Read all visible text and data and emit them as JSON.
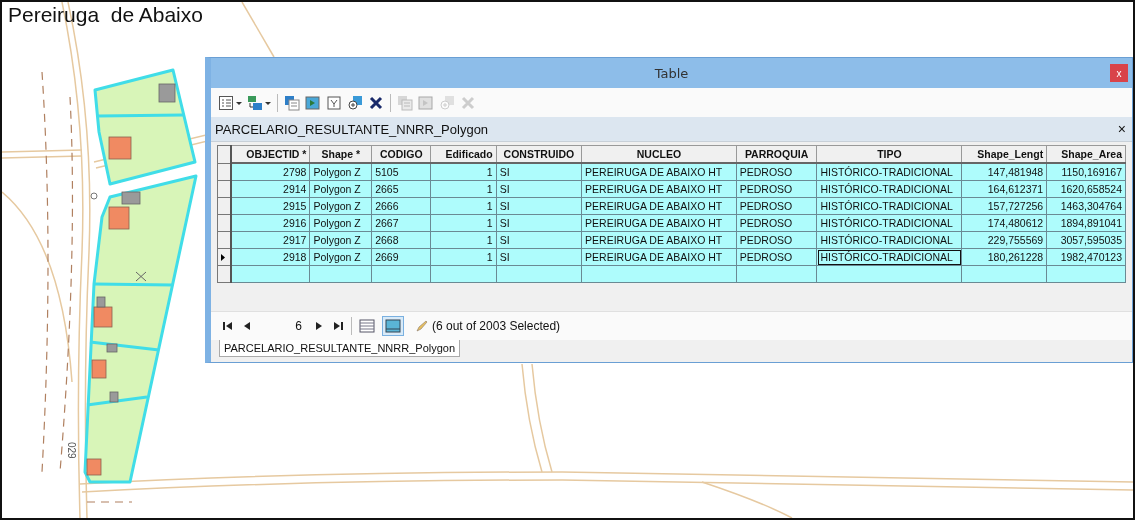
{
  "map": {
    "title": "Pereiruga  de Abaixo",
    "road_label": "029"
  },
  "window": {
    "title": "Table",
    "close": "x"
  },
  "toolbar": [
    {
      "kind": "options",
      "menu": true,
      "disabled": false
    },
    {
      "kind": "related",
      "menu": true,
      "disabled": false
    },
    {
      "kind": "select-attr",
      "menu": false,
      "disabled": false
    },
    {
      "kind": "switch",
      "menu": false,
      "disabled": false
    },
    {
      "kind": "clear",
      "menu": false,
      "disabled": false
    },
    {
      "kind": "zoom",
      "menu": false,
      "disabled": false
    },
    {
      "kind": "delete",
      "menu": false,
      "disabled": false
    },
    {
      "kind": "select-attr",
      "menu": false,
      "disabled": true
    },
    {
      "kind": "switch",
      "menu": false,
      "disabled": true
    },
    {
      "kind": "zoom",
      "menu": false,
      "disabled": true
    },
    {
      "kind": "delete",
      "menu": false,
      "disabled": true
    }
  ],
  "layer": {
    "title": "PARCELARIO_RESULTANTE_NNRR_Polygon",
    "close": "×"
  },
  "table": {
    "columns": [
      {
        "label": "OBJECTID *",
        "kind": "number",
        "focused": false
      },
      {
        "label": "Shape *",
        "kind": "text",
        "focused": false
      },
      {
        "label": "CODIGO",
        "kind": "text",
        "focused": false
      },
      {
        "label": "Edificado",
        "kind": "number",
        "focused": false
      },
      {
        "label": "CONSTRUIDO",
        "kind": "text",
        "focused": false
      },
      {
        "label": "NUCLEO",
        "kind": "text",
        "focused": false
      },
      {
        "label": "PARROQUIA",
        "kind": "text",
        "focused": false
      },
      {
        "label": "TIPO",
        "kind": "text",
        "focused": true
      },
      {
        "label": "Shape_Lengt",
        "kind": "number",
        "focused": false
      },
      {
        "label": "Shape_Area",
        "kind": "number",
        "focused": false
      }
    ],
    "rows": [
      {
        "selected": true,
        "current": false,
        "cells": [
          "2798",
          "Polygon Z",
          "5105",
          "1",
          "SI",
          "PEREIRUGA DE ABAIXO HT",
          "PEDROSO",
          "HISTÓRICO-TRADICIONAL",
          "147,481948",
          "1150,169167"
        ]
      },
      {
        "selected": true,
        "current": false,
        "cells": [
          "2914",
          "Polygon Z",
          "2665",
          "1",
          "SI",
          "PEREIRUGA DE ABAIXO HT",
          "PEDROSO",
          "HISTÓRICO-TRADICIONAL",
          "164,612371",
          "1620,658524"
        ]
      },
      {
        "selected": true,
        "current": false,
        "cells": [
          "2915",
          "Polygon Z",
          "2666",
          "1",
          "SI",
          "PEREIRUGA DE ABAIXO HT",
          "PEDROSO",
          "HISTÓRICO-TRADICIONAL",
          "157,727256",
          "1463,304764"
        ]
      },
      {
        "selected": true,
        "current": false,
        "cells": [
          "2916",
          "Polygon Z",
          "2667",
          "1",
          "SI",
          "PEREIRUGA DE ABAIXO HT",
          "PEDROSO",
          "HISTÓRICO-TRADICIONAL",
          "174,480612",
          "1894,891041"
        ]
      },
      {
        "selected": true,
        "current": false,
        "cells": [
          "2917",
          "Polygon Z",
          "2668",
          "1",
          "SI",
          "PEREIRUGA DE ABAIXO HT",
          "PEDROSO",
          "HISTÓRICO-TRADICIONAL",
          "229,755569",
          "3057,595035"
        ]
      },
      {
        "selected": true,
        "current": true,
        "cells": [
          "2918",
          "Polygon Z",
          "2669",
          "1",
          "SI",
          "PEREIRUGA DE ABAIXO HT",
          "PEDROSO",
          "HISTÓRICO-TRADICIONAL",
          "180,261228",
          "1982,470123"
        ]
      }
    ]
  },
  "navigator": {
    "record": "6",
    "views": [
      {
        "kind": "all",
        "selected": false
      },
      {
        "kind": "selected",
        "selected": true
      }
    ],
    "status": "(6 out of 2003 Selected)"
  },
  "tabs": [
    {
      "label": "PARCELARIO_RESULTANTE_NNRR_Polygon",
      "selected": true
    }
  ]
}
